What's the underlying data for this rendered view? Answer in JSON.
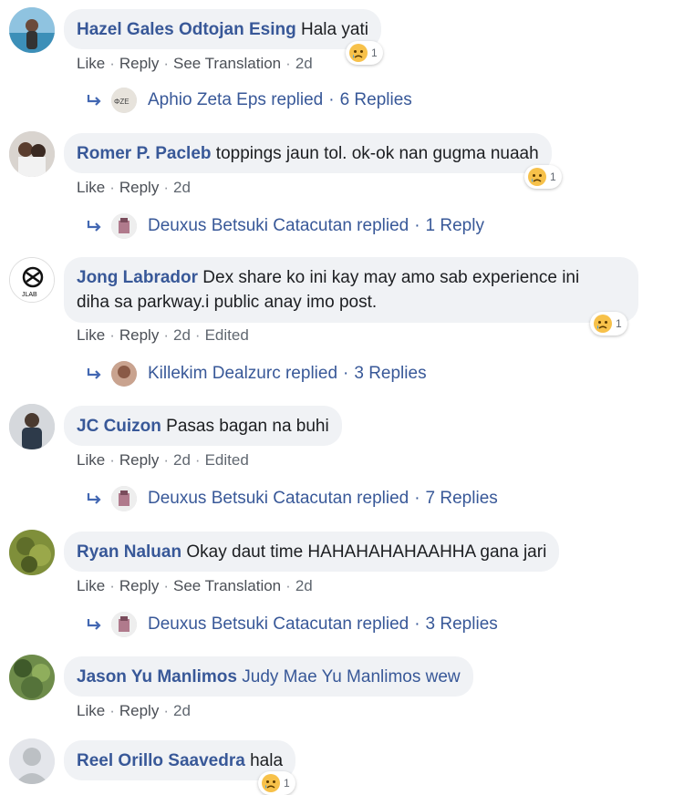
{
  "comments": [
    {
      "author": "Hazel Gales Odtojan Esing",
      "text": "Hala yati",
      "actions": [
        "Like",
        "Reply",
        "See Translation",
        "2d"
      ],
      "reaction": {
        "icon": "sad-face-icon",
        "count": "1"
      },
      "replies": {
        "name": "Aphio Zeta Eps replied",
        "count": "6 Replies"
      }
    },
    {
      "author": "Romer P. Pacleb",
      "text": "toppings jaun tol. ok-ok nan gugma nuaah",
      "actions": [
        "Like",
        "Reply",
        "2d"
      ],
      "reaction": {
        "icon": "sad-face-icon",
        "count": "1"
      },
      "replies": {
        "name": "Deuxus Betsuki Catacutan replied",
        "count": "1 Reply"
      }
    },
    {
      "author": "Jong Labrador",
      "text_line1": "Dex share ko ini kay may amo sab experience ini",
      "text_line2": "diha sa parkway.i public anay imo post.",
      "actions": [
        "Like",
        "Reply",
        "2d",
        "Edited"
      ],
      "reaction": {
        "icon": "sad-face-icon",
        "count": "1"
      },
      "replies": {
        "name": "Killekim Dealzurc replied",
        "count": "3 Replies"
      }
    },
    {
      "author": "JC Cuizon",
      "text": "Pasas bagan na buhi",
      "actions": [
        "Like",
        "Reply",
        "2d",
        "Edited"
      ],
      "replies": {
        "name": "Deuxus Betsuki Catacutan replied",
        "count": "7 Replies"
      }
    },
    {
      "author": "Ryan Naluan",
      "text": "Okay daut time HAHAHAHAHAAHHA gana jari",
      "actions": [
        "Like",
        "Reply",
        "See Translation",
        "2d"
      ],
      "replies": {
        "name": "Deuxus Betsuki Catacutan replied",
        "count": "3 Replies"
      }
    },
    {
      "author": "Jason Yu Manlimos",
      "text": "Judy Mae Yu Manlimos wew",
      "actions": [
        "Like",
        "Reply",
        "2d"
      ]
    },
    {
      "author": "Reel Orillo Saavedra",
      "text": "hala",
      "reaction": {
        "icon": "sad-face-icon",
        "count": "1"
      }
    }
  ],
  "colors": {
    "link": "#385898",
    "bubble": "#f0f2f5",
    "meta": "#606770"
  }
}
